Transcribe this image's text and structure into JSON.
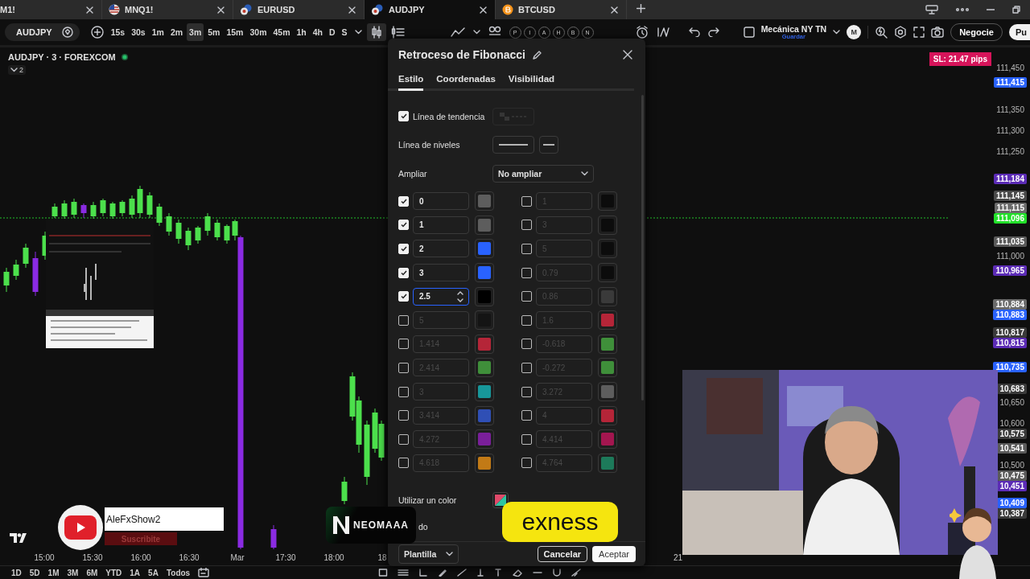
{
  "browser_tabs": [
    {
      "label": "M1!",
      "kind": "plain",
      "selected": false
    },
    {
      "label": "MNQ1!",
      "kind": "flag",
      "selected": false
    },
    {
      "label": "EURUSD",
      "kind": "forex",
      "selected": false
    },
    {
      "label": "AUDJPY",
      "kind": "forex",
      "selected": true
    },
    {
      "label": "BTCUSD",
      "kind": "crypto",
      "selected": false
    }
  ],
  "toolbar": {
    "symbol": "AUDJPY",
    "intervals": [
      {
        "label": "15s",
        "selected": false
      },
      {
        "label": "30s",
        "selected": false
      },
      {
        "label": "1m",
        "selected": false
      },
      {
        "label": "2m",
        "selected": false
      },
      {
        "label": "3m",
        "selected": true
      },
      {
        "label": "5m",
        "selected": false
      },
      {
        "label": "15m",
        "selected": false
      },
      {
        "label": "30m",
        "selected": false
      },
      {
        "label": "45m",
        "selected": false
      },
      {
        "label": "1h",
        "selected": false
      },
      {
        "label": "4h",
        "selected": false
      },
      {
        "label": "D",
        "selected": false
      },
      {
        "label": "S",
        "selected": false
      }
    ],
    "tool_letters": [
      "P",
      "I",
      "A",
      "H",
      "B",
      "N"
    ],
    "layout_name": "Mecánica NY TN",
    "layout_status": "Guardar",
    "avatar": "M",
    "trade_button": "Negocie",
    "publish_button": "Pu"
  },
  "chart": {
    "legend": "AUDJPY · 3 · FOREXCOM",
    "indicator_count": "2",
    "sl_badge": "SL: 21.47 pips",
    "price_labels": [
      {
        "text": "111,450",
        "kind": "grid"
      },
      {
        "text": "111,415",
        "kind": "tag",
        "color": "#2962ff"
      },
      {
        "text": "111,350",
        "kind": "grid"
      },
      {
        "text": "111,300",
        "kind": "grid"
      },
      {
        "text": "111,250",
        "kind": "grid"
      },
      {
        "text": "111,184",
        "kind": "tag",
        "color": "#5b2bb5"
      },
      {
        "text": "111,145",
        "kind": "tag",
        "color": "#4a4a4a"
      },
      {
        "text": "111,115",
        "kind": "tag",
        "color": "#6a6a6a"
      },
      {
        "text": "111,096",
        "kind": "tag",
        "color": "#22e02a"
      },
      {
        "text": "111,035",
        "kind": "tag",
        "color": "#5a5a5a"
      },
      {
        "text": "111,000",
        "kind": "grid"
      },
      {
        "text": "110,965",
        "kind": "tag",
        "color": "#5b2bb5"
      },
      {
        "text": "110,884",
        "kind": "tag",
        "color": "#6a6a6a"
      },
      {
        "text": "110,883",
        "kind": "tag",
        "color": "#2962ff"
      },
      {
        "text": "110,817",
        "kind": "tag",
        "color": "#3a3a3a"
      },
      {
        "text": "110,815",
        "kind": "tag",
        "color": "#5b2bb5"
      },
      {
        "text": "110,735",
        "kind": "tag",
        "color": "#2962ff"
      },
      {
        "text": "10,683",
        "kind": "tag",
        "color": "#3a3a3a"
      },
      {
        "text": "10,650",
        "kind": "grid"
      },
      {
        "text": "10,600",
        "kind": "grid"
      },
      {
        "text": "10,575",
        "kind": "tag",
        "color": "#3a3a3a"
      },
      {
        "text": "10,541",
        "kind": "tag",
        "color": "#5a5a5a"
      },
      {
        "text": "10,500",
        "kind": "grid"
      },
      {
        "text": "10,475",
        "kind": "tag",
        "color": "#5a5a5a"
      },
      {
        "text": "10,451",
        "kind": "tag",
        "color": "#5b2bb5"
      },
      {
        "text": "10,409",
        "kind": "tag",
        "color": "#2962ff"
      },
      {
        "text": "10,387",
        "kind": "tag",
        "color": "#3a3a3a"
      }
    ],
    "time_labels": [
      "15:00",
      "15:30",
      "16:00",
      "16:30",
      "Mar",
      "17:30",
      "18:00",
      "18"
    ],
    "time_label_edge": "21"
  },
  "range_bar": [
    "1D",
    "5D",
    "1M",
    "3M",
    "6M",
    "YTD",
    "1A",
    "5A",
    "Todos"
  ],
  "dialog": {
    "title": "Retroceso de Fibonacci",
    "tabs": [
      {
        "label": "Estilo",
        "selected": true
      },
      {
        "label": "Coordenadas",
        "selected": false
      },
      {
        "label": "Visibilidad",
        "selected": false
      }
    ],
    "trend_line": {
      "label": "Línea de tendencia",
      "checked": true
    },
    "levels_line": {
      "label": "Línea de niveles"
    },
    "extend": {
      "label": "Ampliar",
      "value": "No ampliar"
    },
    "levels_left": [
      {
        "value": "0",
        "checked": true,
        "focused": false,
        "color": "#5d5d5d"
      },
      {
        "value": "1",
        "checked": true,
        "focused": false,
        "color": "#5d5d5d"
      },
      {
        "value": "2",
        "checked": true,
        "focused": false,
        "color": "#2962ff"
      },
      {
        "value": "3",
        "checked": true,
        "focused": false,
        "color": "#2962ff"
      },
      {
        "value": "2.5",
        "checked": true,
        "focused": true,
        "color": "#000000"
      },
      {
        "value": "5",
        "checked": false,
        "focused": false,
        "color": "#141414"
      },
      {
        "value": "1.414",
        "checked": false,
        "focused": false,
        "color": "#b52538"
      },
      {
        "value": "2.414",
        "checked": false,
        "focused": false,
        "color": "#3f8f3a"
      },
      {
        "value": "3",
        "checked": false,
        "focused": false,
        "color": "#17979a"
      },
      {
        "value": "3.414",
        "checked": false,
        "focused": false,
        "color": "#2f4fb5"
      },
      {
        "value": "4.272",
        "checked": false,
        "focused": false,
        "color": "#7a1f9a"
      },
      {
        "value": "4.618",
        "checked": false,
        "focused": false,
        "color": "#c27a16"
      }
    ],
    "levels_right": [
      {
        "value": "1",
        "checked": false,
        "focused": false,
        "color": "#0c0c0c"
      },
      {
        "value": "3",
        "checked": false,
        "focused": false,
        "color": "#0c0c0c"
      },
      {
        "value": "5",
        "checked": false,
        "focused": false,
        "color": "#0c0c0c"
      },
      {
        "value": "0.79",
        "checked": false,
        "focused": false,
        "color": "#0c0c0c"
      },
      {
        "value": "0.86",
        "checked": false,
        "focused": false,
        "color": "#3a3a3a"
      },
      {
        "value": "1.6",
        "checked": false,
        "focused": false,
        "color": "#b52538"
      },
      {
        "value": "-0.618",
        "checked": false,
        "focused": false,
        "color": "#3f8f3a"
      },
      {
        "value": "-0.272",
        "checked": false,
        "focused": false,
        "color": "#3f8f3a"
      },
      {
        "value": "3.272",
        "checked": false,
        "focused": false,
        "color": "#5d5d5d"
      },
      {
        "value": "4",
        "checked": false,
        "focused": false,
        "color": "#b52538"
      },
      {
        "value": "4.414",
        "checked": false,
        "focused": false,
        "color": "#a3164f"
      },
      {
        "value": "4.764",
        "checked": false,
        "focused": false,
        "color": "#1d7a5a"
      }
    ],
    "single_color": {
      "label": "Utilizar un color"
    },
    "background": {
      "label": "do"
    },
    "template_button": "Plantilla",
    "cancel_button": "Cancelar",
    "ok_button": "Aceptar"
  },
  "overlays": {
    "youtube_handle": "AleFxShow2",
    "subscribe": "Suscribite",
    "sponsor_one": "NEOMAAA",
    "sponsor_two": "exness"
  }
}
